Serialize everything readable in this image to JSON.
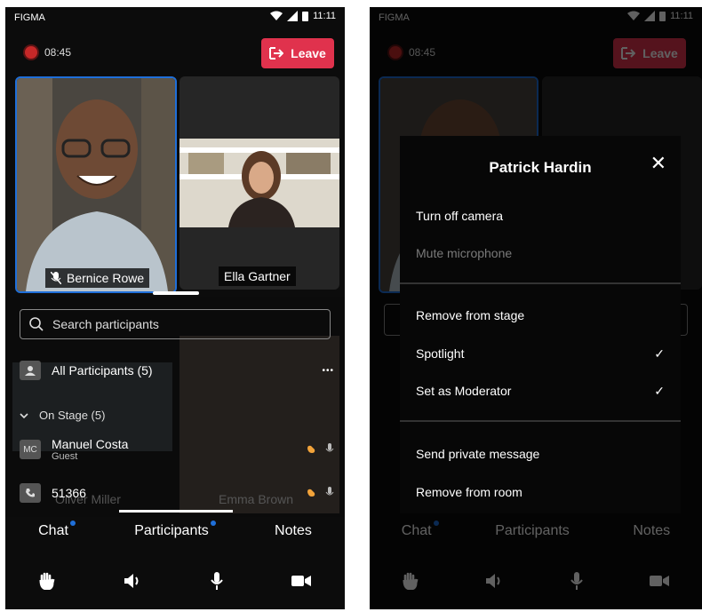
{
  "status": {
    "carrier": "FIGMA",
    "time": "11:11"
  },
  "call": {
    "duration": "08:45",
    "leave_label": "Leave"
  },
  "stage": {
    "tiles": [
      {
        "name": "Bernice Rowe"
      },
      {
        "name": "Ella Gartner"
      }
    ]
  },
  "participants_sheet": {
    "search_placeholder": "Search participants",
    "all_label": "All Participants (5)",
    "more_label": "•••",
    "on_stage_label": "On Stage (5)",
    "rows": [
      {
        "initials": "MC",
        "name": "Manuel Costa",
        "role": "Guest"
      },
      {
        "initials": "",
        "name": "51366",
        "role": ""
      }
    ],
    "background_names": [
      "Oliver Miller",
      "Emma Brown"
    ]
  },
  "tabs": [
    {
      "label": "Chat",
      "has_dot": true
    },
    {
      "label": "Participants",
      "has_dot": true
    },
    {
      "label": "Notes",
      "has_dot": false
    }
  ],
  "toolbar": {
    "items": [
      {
        "icon": "raise-hand-icon"
      },
      {
        "icon": "speaker-icon"
      },
      {
        "icon": "microphone-icon"
      },
      {
        "icon": "video-camera-icon"
      }
    ]
  },
  "context_menu": {
    "title": "Patrick Hardin",
    "close_label": "✕",
    "items": [
      {
        "label": "Turn off camera",
        "enabled": true,
        "checked": false
      },
      {
        "label": "Mute microphone",
        "enabled": false,
        "checked": false
      },
      {
        "label": "Remove from stage",
        "enabled": true,
        "checked": false
      },
      {
        "label": "Spotlight",
        "enabled": true,
        "checked": true
      },
      {
        "label": "Set as Moderator",
        "enabled": true,
        "checked": true
      },
      {
        "label": "Send private message",
        "enabled": true,
        "checked": false
      },
      {
        "label": "Remove from room",
        "enabled": true,
        "checked": false
      }
    ]
  },
  "colors": {
    "accent_red": "#e0324d",
    "notification_blue": "#1f6fd9",
    "background": "#0c0c0c"
  }
}
